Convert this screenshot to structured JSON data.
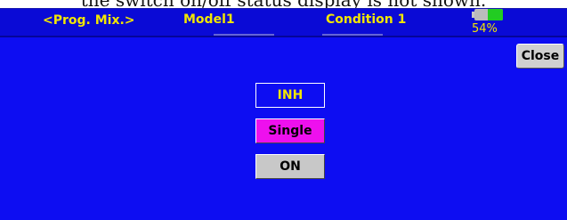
{
  "caption": "the switch on/off status display is not shown.",
  "header": {
    "screen_name": "<Prog. Mix.>",
    "model": "Model1",
    "condition": "Condition 1",
    "battery_percent_label": "54%",
    "battery_level": 0.54
  },
  "buttons": {
    "close": "Close",
    "inh": "INH",
    "single": "Single",
    "on": "ON"
  },
  "colors": {
    "background": "#0d0df2",
    "header_text": "#f2e600",
    "single_active": "#ee10ee",
    "on_button": "#c8c8c8"
  }
}
